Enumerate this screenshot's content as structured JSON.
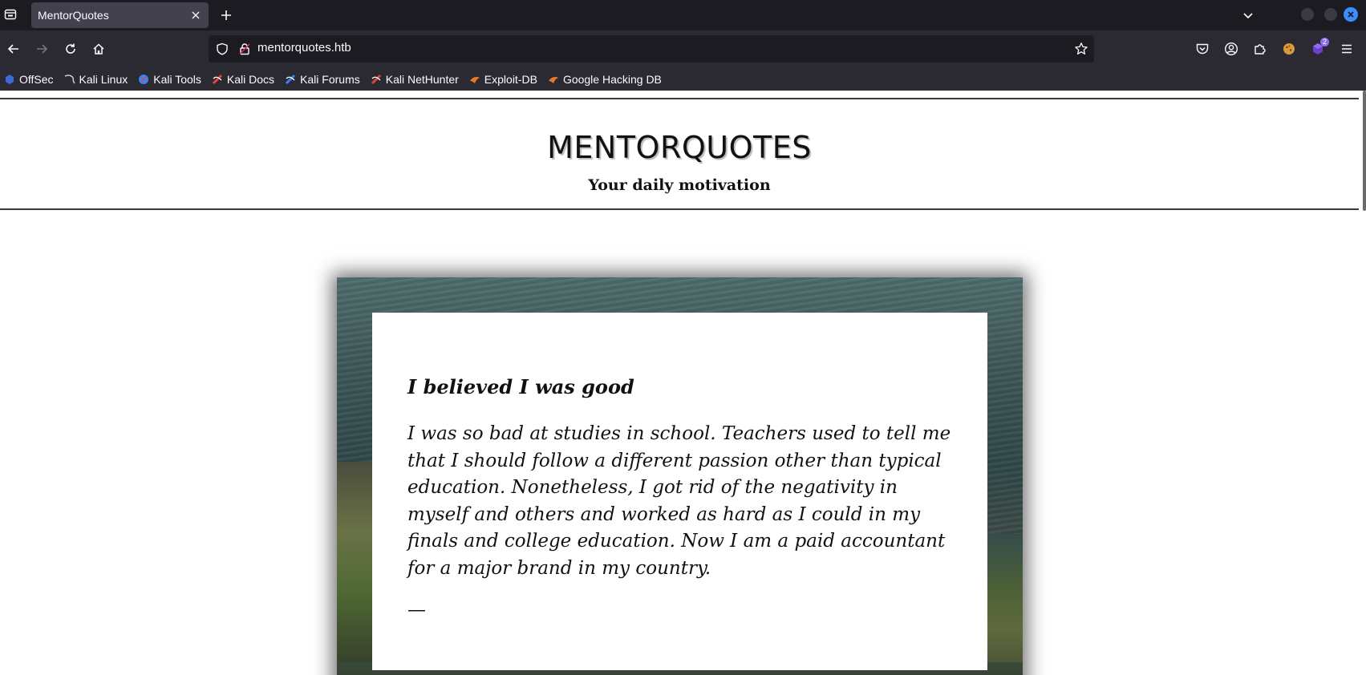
{
  "browser": {
    "tab": {
      "title": "MentorQuotes"
    },
    "url": "mentorquotes.htb",
    "extensions_badge": "2",
    "bookmarks": [
      {
        "label": "OffSec",
        "icon": "offsec-icon",
        "color": "#3a6ad6"
      },
      {
        "label": "Kali Linux",
        "icon": "kali-linux-icon",
        "color": "#bfbfbf"
      },
      {
        "label": "Kali Tools",
        "icon": "kali-tools-icon",
        "color": "#3b82f6"
      },
      {
        "label": "Kali Docs",
        "icon": "kali-docs-icon",
        "color": "#e0463a"
      },
      {
        "label": "Kali Forums",
        "icon": "kali-forums-icon",
        "color": "#3b82f6"
      },
      {
        "label": "Kali NetHunter",
        "icon": "kali-nethunter-icon",
        "color": "#e0463a"
      },
      {
        "label": "Exploit-DB",
        "icon": "exploit-db-icon",
        "color": "#e8792b"
      },
      {
        "label": "Google Hacking DB",
        "icon": "ghdb-icon",
        "color": "#e8792b"
      }
    ]
  },
  "page": {
    "title": "MENTORQUOTES",
    "subtitle": "Your daily motivation",
    "quote": {
      "title": "I believed I was good",
      "body": "I was so bad at studies in school. Teachers used to tell me that I should follow a different passion other than typical education. Nonetheless, I got rid of the negativity in myself and others and worked as hard as I could in my finals and college education. Now I am a paid accountant for a major brand in my country.",
      "author": "—"
    }
  },
  "colors": {
    "chrome_dark": "#1c1b22",
    "chrome": "#2b2a33",
    "tab_active": "#42414d",
    "accent_blue": "#3a8dff"
  }
}
